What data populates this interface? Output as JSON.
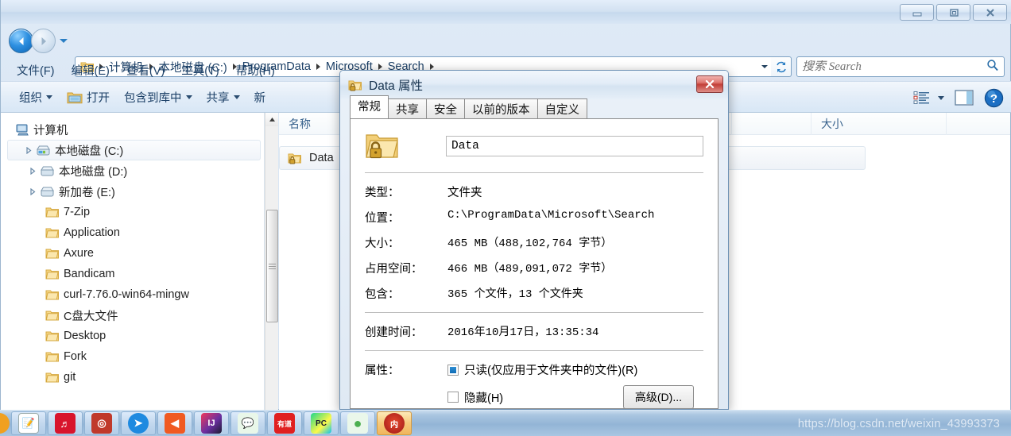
{
  "window": {
    "controls": {
      "minimize": "minimize-icon",
      "restore": "restore-icon",
      "close": "close-icon"
    }
  },
  "address": {
    "breadcrumbs": [
      "计算机",
      "本地磁盘 (C:)",
      "ProgramData",
      "Microsoft",
      "Search"
    ],
    "folder_icon": "folder-icon",
    "dropdown_icon": "chevron-down-icon",
    "refresh_icon": "refresh-icon"
  },
  "search": {
    "placeholder": "搜索 Search",
    "value": "",
    "icon": "search-icon"
  },
  "menubar": {
    "items": [
      "文件(F)",
      "编辑(E)",
      "查看(V)",
      "工具(T)",
      "帮助(H)"
    ]
  },
  "toolbar": {
    "items": [
      {
        "label": "组织",
        "caret": true,
        "icon": null
      },
      {
        "label": "打开",
        "caret": false,
        "icon": "open-folder-icon"
      },
      {
        "label": "包含到库中",
        "caret": true,
        "icon": null
      },
      {
        "label": "共享",
        "caret": true,
        "icon": null
      },
      {
        "label": "新",
        "caret": false,
        "icon": null
      }
    ],
    "view_icon": "view-list-icon",
    "view_caret": "chevron-down-icon",
    "preview_icon": "preview-pane-icon",
    "help_icon": "help-icon"
  },
  "navpane": {
    "items": [
      {
        "label": "计算机",
        "icon": "computer-icon",
        "indent": 0,
        "arrow": "none",
        "selected": false
      },
      {
        "label": "本地磁盘 (C:)",
        "icon": "drive-system-icon",
        "indent": 1,
        "arrow": "collapsed",
        "selected": true
      },
      {
        "label": "本地磁盘 (D:)",
        "icon": "drive-icon",
        "indent": 1,
        "arrow": "collapsed",
        "selected": false
      },
      {
        "label": "新加卷 (E:)",
        "icon": "drive-icon",
        "indent": 1,
        "arrow": "collapsed",
        "selected": false
      },
      {
        "label": "7-Zip",
        "icon": "folder-icon",
        "indent": 2,
        "arrow": "none",
        "selected": false
      },
      {
        "label": "Application",
        "icon": "folder-icon",
        "indent": 2,
        "arrow": "none",
        "selected": false
      },
      {
        "label": "Axure",
        "icon": "folder-icon",
        "indent": 2,
        "arrow": "none",
        "selected": false
      },
      {
        "label": "Bandicam",
        "icon": "folder-icon",
        "indent": 2,
        "arrow": "none",
        "selected": false
      },
      {
        "label": "curl-7.76.0-win64-mingw",
        "icon": "folder-icon",
        "indent": 2,
        "arrow": "none",
        "selected": false
      },
      {
        "label": "C盘大文件",
        "icon": "folder-icon",
        "indent": 2,
        "arrow": "none",
        "selected": false
      },
      {
        "label": "Desktop",
        "icon": "folder-icon",
        "indent": 2,
        "arrow": "none",
        "selected": false
      },
      {
        "label": "Fork",
        "icon": "folder-icon",
        "indent": 2,
        "arrow": "none",
        "selected": false
      },
      {
        "label": "git",
        "icon": "folder-icon",
        "indent": 2,
        "arrow": "none",
        "selected": false
      }
    ]
  },
  "filelist": {
    "columns": [
      "名称",
      "大小"
    ],
    "rows": [
      {
        "name": "Data",
        "icon": "locked-folder-icon"
      }
    ]
  },
  "dialog": {
    "title": "Data 属性",
    "title_icon": "locked-folder-icon",
    "close_icon": "close-icon",
    "tabs": [
      {
        "label": "常规",
        "active": true
      },
      {
        "label": "共享",
        "active": false
      },
      {
        "label": "安全",
        "active": false
      },
      {
        "label": "以前的版本",
        "active": false
      },
      {
        "label": "自定义",
        "active": false
      }
    ],
    "folder_icon": "locked-folder-icon",
    "name_value": "Data",
    "properties": [
      {
        "label": "类型：",
        "value": "文件夹",
        "cjk": true
      },
      {
        "label": "位置：",
        "value": "C:\\ProgramData\\Microsoft\\Search",
        "cjk": false
      },
      {
        "label": "大小：",
        "value": "465 MB（488,102,764 字节）",
        "cjk": false
      },
      {
        "label": "占用空间：",
        "value": "466 MB（489,091,072 字节）",
        "cjk": false
      },
      {
        "label": "包含：",
        "value": "365 个文件，13 个文件夹",
        "cjk": false
      }
    ],
    "created": {
      "label": "创建时间：",
      "value": "2016年10月17日，13:35:34"
    },
    "attributes": {
      "label": "属性：",
      "readonly": {
        "label": "只读(仅应用于文件夹中的文件)(R)",
        "state": "filled"
      },
      "hidden": {
        "label": "隐藏(H)",
        "state": "unchecked"
      },
      "advanced_button": "高级(D)..."
    }
  },
  "taskbar": {
    "buttons": [
      {
        "name": "taskbar-app-notepad",
        "glyph": "📝",
        "color": "#ffffff",
        "active": false
      },
      {
        "name": "taskbar-app-netease-music",
        "glyph": "♬",
        "color": "#d8142c",
        "active": false
      },
      {
        "name": "taskbar-app-snail",
        "glyph": "◎",
        "color": "#c0392b",
        "active": false
      },
      {
        "name": "taskbar-app-messenger",
        "glyph": "➤",
        "color": "#1e8ae0",
        "active": false
      },
      {
        "name": "taskbar-app-orange",
        "glyph": "◀",
        "color": "#f05a22",
        "active": false
      },
      {
        "name": "taskbar-app-intellij-idea",
        "glyph": "IJ",
        "color": "#6b2fa0",
        "active": false
      },
      {
        "name": "taskbar-app-wechat",
        "glyph": "💬",
        "color": "#3ec93e",
        "active": false
      },
      {
        "name": "taskbar-app-youdao",
        "glyph": "有道",
        "color": "#e02020",
        "active": false
      },
      {
        "name": "taskbar-app-pycharm",
        "glyph": "PC",
        "color": "#21d789",
        "active": false
      },
      {
        "name": "taskbar-app-green",
        "glyph": "●",
        "color": "#4caf50",
        "active": false
      },
      {
        "name": "taskbar-app-active",
        "glyph": "内",
        "color": "#b3261e",
        "active": true
      }
    ]
  },
  "watermark": "https://blog.csdn.net/weixin_43993373"
}
